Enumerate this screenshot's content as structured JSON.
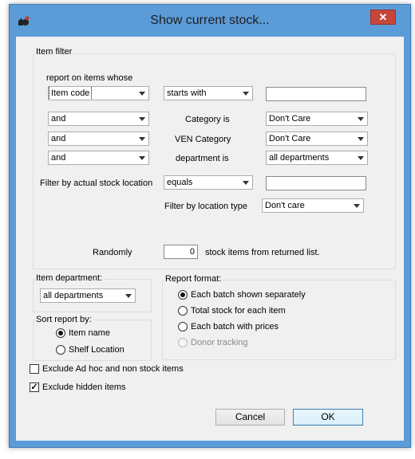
{
  "window": {
    "title": "Show current stock..."
  },
  "item_filter": {
    "legend": "Item filter",
    "report_label": "report on items whose",
    "field_combo": "Item code",
    "operator_combo": "starts with",
    "value_input": "",
    "rows": [
      {
        "conj": "and",
        "label": "Category is",
        "value": "Don't Care"
      },
      {
        "conj": "and",
        "label": "VEN Category",
        "value": "Don't Care"
      },
      {
        "conj": "and",
        "label": "department is",
        "value": "all departments"
      }
    ],
    "location_label": "Filter by actual stock location",
    "location_operator": "equals",
    "location_value": "",
    "location_type_label": "Filter by location type",
    "location_type_value": "Don't care",
    "randomly_label": "Randomly",
    "random_count": "0",
    "random_suffix": "stock items from returned list."
  },
  "item_department": {
    "legend": "Item department:",
    "value": "all departments"
  },
  "sort_report": {
    "legend": "Sort report by:",
    "options": [
      {
        "label": "Item name",
        "selected": true
      },
      {
        "label": "Shelf Location",
        "selected": false
      }
    ]
  },
  "report_format": {
    "legend": "Report format:",
    "options": [
      {
        "label": "Each batch shown separately",
        "selected": true,
        "disabled": false
      },
      {
        "label": "Total stock for each item",
        "selected": false,
        "disabled": false
      },
      {
        "label": "Each batch with prices",
        "selected": false,
        "disabled": false
      },
      {
        "label": "Donor tracking",
        "selected": false,
        "disabled": true
      }
    ]
  },
  "checkboxes": [
    {
      "label": "Exclude Ad hoc and non stock items",
      "checked": false
    },
    {
      "label": "Exclude hidden items",
      "checked": true
    }
  ],
  "buttons": {
    "cancel": "Cancel",
    "ok": "OK"
  },
  "icons": {
    "app": "mSupply-logo-icon",
    "close": "close-icon",
    "dropdown": "chevron-down-icon"
  },
  "colors": {
    "titlebar": "#5b9bd8",
    "close": "#c7463b",
    "dialog_bg": "#f0f0f0"
  }
}
